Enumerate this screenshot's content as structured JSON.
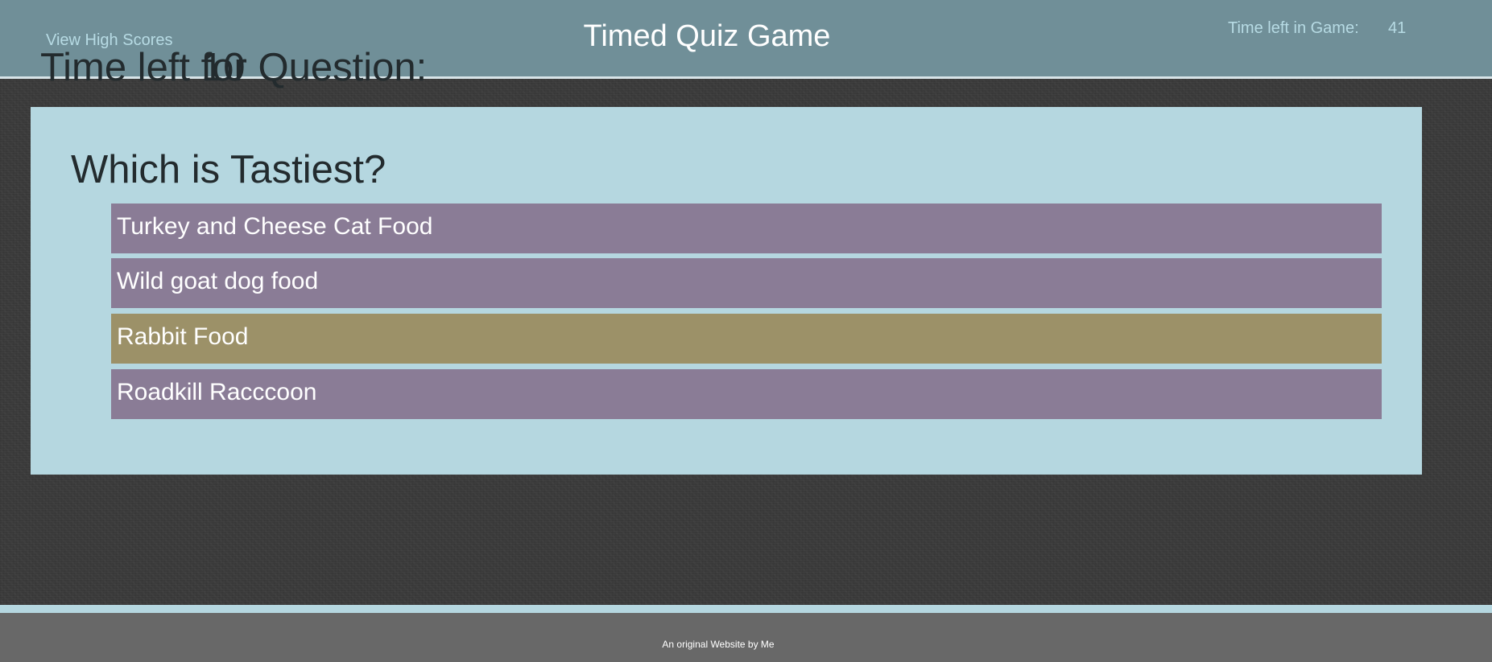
{
  "header": {
    "high_scores_link": "View High Scores",
    "title": "Timed Quiz Game",
    "timers": {
      "game_label": "Time left in Game:",
      "game_value": "41",
      "question_label": "Time left for Question:",
      "question_value": "10"
    }
  },
  "quiz": {
    "question": "Which is Tastiest?",
    "answers": [
      {
        "label": "Turkey and Cheese Cat Food",
        "state": "normal"
      },
      {
        "label": "Wild goat dog food",
        "state": "normal"
      },
      {
        "label": "Rabbit Food",
        "state": "highlighted"
      },
      {
        "label": "Roadkill Racccoon",
        "state": "normal"
      }
    ]
  },
  "footer": {
    "text": "An original Website by Me"
  },
  "colors": {
    "header_bg": "#708f98",
    "card_bg": "#b5d7e0",
    "answer_bg": "#8a7c96",
    "answer_highlight_bg": "#9c9168",
    "footer_bg": "#686868",
    "link": "#b7dbe4"
  }
}
